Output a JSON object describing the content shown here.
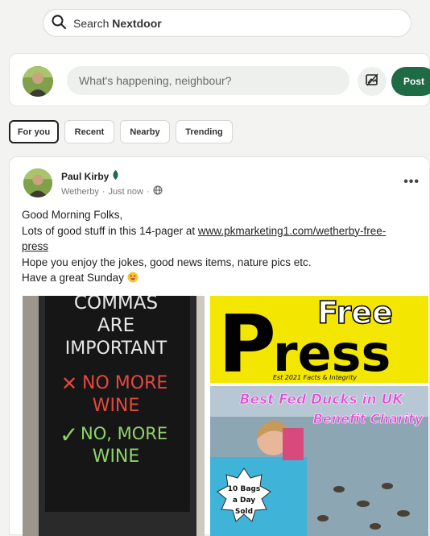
{
  "search": {
    "label": "Search",
    "brand": "Nextdoor"
  },
  "composer": {
    "placeholder": "What's happening, neighbour?",
    "post_label": "Post"
  },
  "tabs": [
    {
      "label": "For you",
      "active": true
    },
    {
      "label": "Recent",
      "active": false
    },
    {
      "label": "Nearby",
      "active": false
    },
    {
      "label": "Trending",
      "active": false
    }
  ],
  "post": {
    "author": "Paul Kirby",
    "location": "Wetherby",
    "time": "Just now",
    "separator": "·",
    "body": {
      "line1": "Good Morning Folks,",
      "line2_prefix": "Lots of good stuff in this 14-pager at ",
      "link_part1": "www.pkmarketing1.com/wetherby-free-",
      "link_part2": "press",
      "line3": "Hope you enjoy the jokes, good news items, nature pics etc.",
      "line4": "Have a great Sunday"
    },
    "images": {
      "chalkboard": {
        "line1": "COMMAS",
        "line2": "ARE",
        "line3": "IMPORTANT",
        "line4": "NO MORE",
        "line5": "WINE",
        "line6": "NO, MORE",
        "line7": "WINE",
        "cross": "✕",
        "check": "✓"
      },
      "newspaper": {
        "free": "Free",
        "p": "P",
        "ress": "ress",
        "tagline": "Est 2021 Facts & Integrity",
        "headline1": "Best Fed Ducks in UK",
        "headline2": "Benefit Charity",
        "badge1": "10 Bags",
        "badge2": "a Day",
        "badge3": "Sold"
      }
    }
  },
  "colors": {
    "accent_green": "#1f6b46",
    "newspaper_yellow": "#f3e600",
    "headline_pink": "#e24bd8"
  },
  "icons": [
    "search-icon",
    "image-icon",
    "leaf-icon",
    "globe-icon",
    "more-icon",
    "wink-emoji"
  ]
}
